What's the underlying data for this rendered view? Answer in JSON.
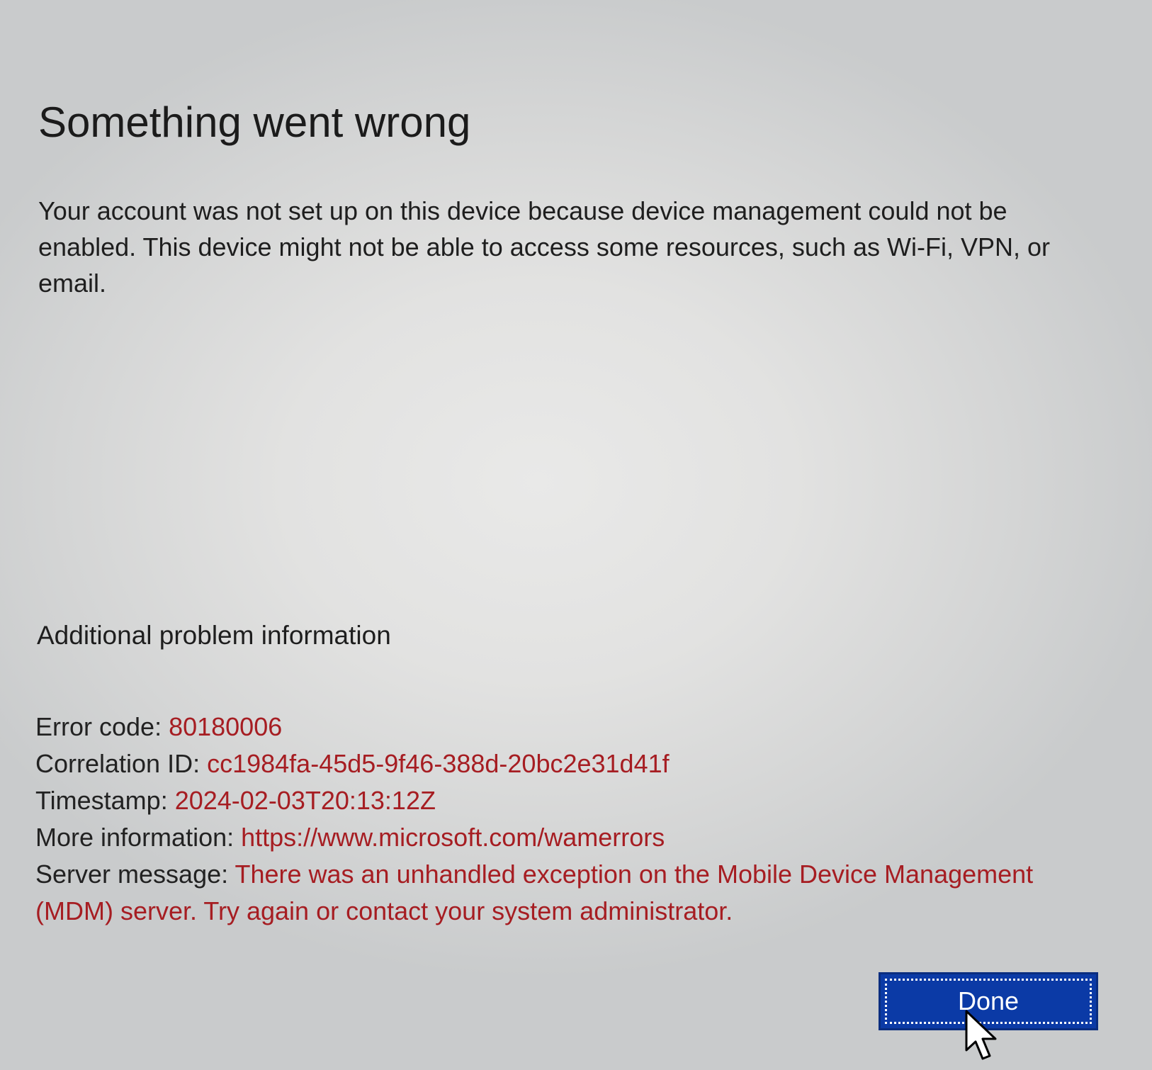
{
  "dialog": {
    "title": "Something went wrong",
    "message": "Your account was not set up on this device because device management could not be enabled. This device might not be able to access some resources, such as Wi-Fi, VPN, or email.",
    "additional_heading": "Additional problem information",
    "details": {
      "error_code_label": "Error code: ",
      "error_code_value": "80180006",
      "correlation_label": "Correlation ID: ",
      "correlation_value": "cc1984fa-45d5-9f46-388d-20bc2e31d41f",
      "timestamp_label": "Timestamp: ",
      "timestamp_value": "2024-02-03T20:13:12Z",
      "more_info_label": "More information: ",
      "more_info_value": "https://www.microsoft.com/wamerrors",
      "server_message_label": "Server message: ",
      "server_message_value": "There was an unhandled exception on the Mobile Device Management (MDM) server. Try again or contact your system administrator."
    },
    "done_label": "Done"
  },
  "colors": {
    "value_text": "#a61d22",
    "button_bg": "#0b3aa6",
    "button_text": "#ffffff"
  },
  "icons": {
    "cursor": "mouse-pointer-arrow"
  }
}
